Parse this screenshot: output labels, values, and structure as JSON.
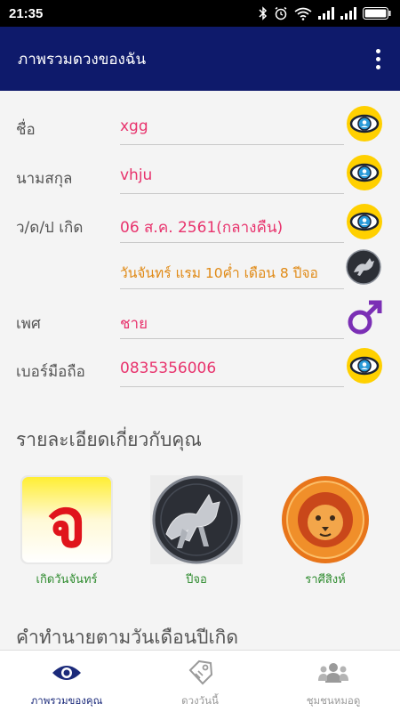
{
  "status_bar": {
    "time": "21:35",
    "icons": [
      "bluetooth-icon",
      "alarm-icon",
      "wifi-icon",
      "signal-icon",
      "signal-icon",
      "battery-icon"
    ]
  },
  "app_bar": {
    "title": "ภาพรวมดวงของฉัน",
    "menu_icon": "more-vert-icon"
  },
  "profile": {
    "name": {
      "label": "ชื่อ",
      "value": "xgg",
      "icon": "eye-icon"
    },
    "surname": {
      "label": "นามสกุล",
      "value": "vhju",
      "icon": "eye-icon"
    },
    "birth": {
      "label": "ว/ด/ป เกิด",
      "value": "06 ส.ค. 2561(กลางคืน)",
      "icon": "eye-icon"
    },
    "lunar": {
      "value": "วันจันทร์ แรม 10ค่ำ เดือน 8 ปีจอ",
      "icon": "dog-zodiac-icon"
    },
    "gender": {
      "label": "เพศ",
      "value": "ชาย",
      "icon": "male-symbol-icon"
    },
    "phone": {
      "label": "เบอร์มือถือ",
      "value": "0835356006",
      "icon": "eye-icon"
    }
  },
  "details": {
    "title": "รายละเอียดเกี่ยวกับคุณ",
    "cards": [
      {
        "caption": "เกิดวันจันทร์",
        "glyph": "จ",
        "icon": "monday-letter-icon"
      },
      {
        "caption": "ปีจอ",
        "icon": "dog-year-icon"
      },
      {
        "caption": "ราศีสิงห์",
        "icon": "leo-lion-icon"
      }
    ]
  },
  "prediction": {
    "title": "คำทำนายตามวันเดือนปีเกิด"
  },
  "bottom_nav": [
    {
      "label": "ภาพรวมของคุณ",
      "icon": "eye-icon",
      "active": true
    },
    {
      "label": "ดวงวันนี้",
      "icon": "tag-icon",
      "active": false
    },
    {
      "label": "ชุมชนหมอดู",
      "icon": "community-icon",
      "active": false
    }
  ],
  "colors": {
    "app_bar": "#0e1a6b",
    "value_text": "#e8336d",
    "lunar_text": "#e08a16",
    "card_caption": "#2e8b2e",
    "eye_icon_bg": "#ffd000",
    "male_symbol": "#7b2fb5"
  }
}
